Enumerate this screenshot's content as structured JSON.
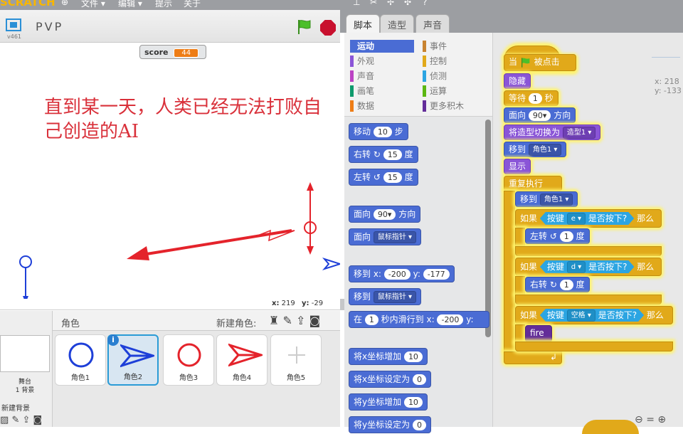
{
  "menubar": {
    "logo": "SCRATCH",
    "menus": [
      "文件 ▾",
      "编辑 ▾",
      "提示",
      "关于"
    ],
    "icons": [
      "globe-icon",
      "duplicate-icon",
      "cut-icon",
      "grow-icon",
      "shrink-icon",
      "help-icon"
    ]
  },
  "stage": {
    "version": "v461",
    "project_title": "PVP",
    "score_label": "score",
    "score_value": "44",
    "message": "直到某一天，人类已经无法打败自己创造的AI",
    "mouse_x_label": "x:",
    "mouse_x": "219",
    "mouse_y_label": "y:",
    "mouse_y": "-29"
  },
  "sprites": {
    "title": "角色",
    "new_sprite_label": "新建角色:",
    "stage_label": "舞台",
    "backdrop_count": "1 背景",
    "new_backdrop_label": "新建背景",
    "items": [
      "角色1",
      "角色2",
      "角色3",
      "角色4",
      "角色5"
    ],
    "info_badge": "i"
  },
  "tabs": [
    "脚本",
    "造型",
    "声音"
  ],
  "categories": {
    "left": [
      "运动",
      "外观",
      "声音",
      "画笔",
      "数据"
    ],
    "right": [
      "事件",
      "控制",
      "侦测",
      "运算",
      "更多积木"
    ]
  },
  "palette": {
    "move": {
      "label": "移动",
      "value": "10",
      "unit": "步"
    },
    "turn_right": {
      "label": "右转",
      "value": "15",
      "unit": "度"
    },
    "turn_left": {
      "label": "左转",
      "value": "15",
      "unit": "度"
    },
    "point_dir": {
      "label": "面向",
      "value": "90",
      "unit": "方向"
    },
    "point_towards": {
      "label": "面向",
      "value": "鼠标指针"
    },
    "goto_xy": {
      "label": "移到 x:",
      "x": "-200",
      "ylabel": "y:",
      "y": "-177"
    },
    "goto": {
      "label": "移到",
      "value": "鼠标指针"
    },
    "glide": {
      "label": "在",
      "secs": "1",
      "mid": "秒内滑行到 x:",
      "x": "-200",
      "ylabel": "y:"
    },
    "change_x": {
      "label": "将x坐标增加",
      "value": "10"
    },
    "set_x": {
      "label": "将x坐标设定为",
      "value": "0"
    },
    "change_y": {
      "label": "将y坐标增加",
      "value": "10"
    },
    "set_y": {
      "label": "将y坐标设定为",
      "value": "0"
    }
  },
  "script": {
    "sprite_x": "x: 218",
    "sprite_y": "y: -133",
    "when_flag_pre": "当",
    "when_flag_post": "被点击",
    "hide": "隐藏",
    "wait_label": "等待",
    "wait_value": "1",
    "wait_unit": "秒",
    "point_label": "面向",
    "point_value": "90",
    "point_unit": "方向",
    "switch_costume": "将造型切换为",
    "costume": "造型1",
    "goto_label": "移到",
    "goto_target": "角色1",
    "show": "显示",
    "forever": "重复执行",
    "loop_goto_label": "移到",
    "loop_goto_target": "角色1",
    "if_label": "如果",
    "key_label": "按键",
    "key_pressed": "是否按下?",
    "then_label": "那么",
    "key1": "e",
    "turn_left_label": "左转",
    "turn_left_value": "1",
    "deg": "度",
    "key2": "d",
    "turn_right_label": "右转",
    "turn_right_value": "1",
    "key3": "空格",
    "fire": "fire"
  },
  "colors": {
    "motion": "#4a6cd4",
    "looks": "#8a55d7",
    "sound": "#bb42c3",
    "pen": "#0e9a6c",
    "data": "#ee7d16",
    "events": "#c88330",
    "control": "#e1a91a",
    "sensing": "#2ca5e2",
    "operators": "#5cb712",
    "more": "#632d99",
    "stage_text": "#d9303a",
    "sprite_red": "#e4232b",
    "sprite_blue": "#1e3fd8"
  }
}
